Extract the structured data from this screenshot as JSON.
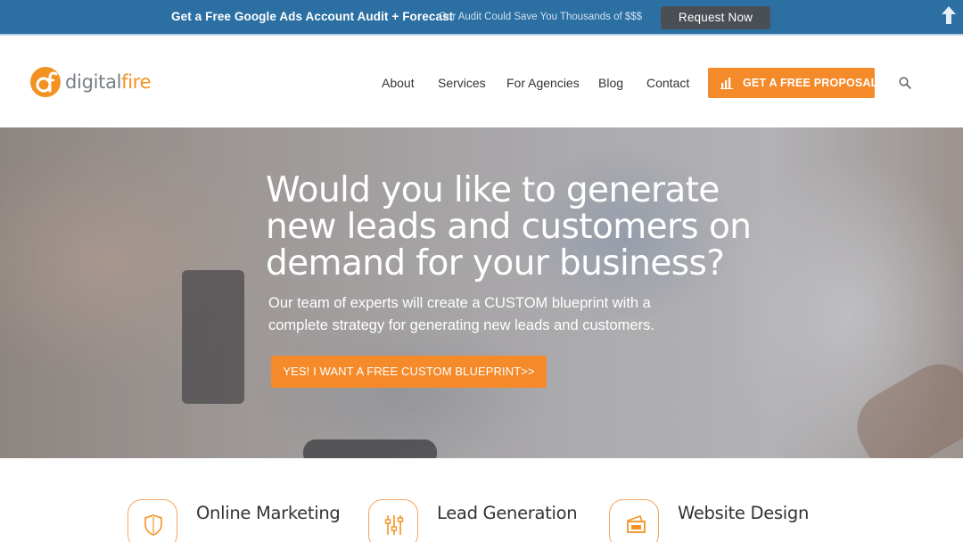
{
  "promo": {
    "headline": "Get a Free Google Ads Account Audit + Forecast",
    "subtext": "Our Audit Could Save You Thousands of $$$",
    "button_label": "Request Now",
    "scroll_icon": "arrow-up-icon"
  },
  "logo": {
    "text_part1": "digital",
    "text_part2": "fire"
  },
  "nav": {
    "items": [
      "About",
      "Services",
      "For Agencies",
      "Blog",
      "Contact"
    ],
    "cta_label": "GET A FREE PROPOSAL",
    "cta_icon": "bar-chart-icon",
    "search_icon": "search-icon"
  },
  "hero": {
    "title": "Would you like to generate new leads and customers on demand for your business?",
    "description": "Our team of experts will create a CUSTOM blueprint with a complete strategy for generating new leads and customers.",
    "cta_label": "YES! I WANT A FREE CUSTOM BLUEPRINT>>"
  },
  "services": [
    {
      "title": "Online Marketing",
      "icon": "shield-icon"
    },
    {
      "title": "Lead Generation",
      "icon": "sliders-icon"
    },
    {
      "title": "Website Design",
      "icon": "browser-icon"
    }
  ],
  "colors": {
    "promo_bg": "#2b6fa3",
    "accent_orange": "#f48a2a",
    "promo_button_bg": "#4a4f55",
    "logo_gray": "#7a7f86"
  }
}
